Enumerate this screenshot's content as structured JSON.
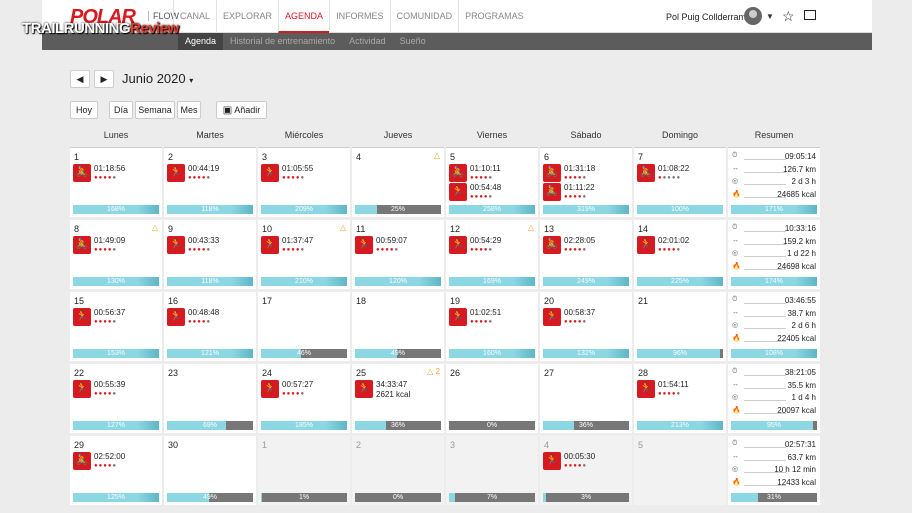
{
  "header": {
    "logo": "POLAR",
    "flow": "FLOW",
    "nav": [
      "CANAL",
      "EXPLORAR",
      "AGENDA",
      "INFORMES",
      "COMUNIDAD",
      "PROGRAMAS"
    ],
    "active": "AGENDA",
    "user": "Pol Puig Collderram"
  },
  "subnav": {
    "items": [
      "Agenda",
      "Historial de entrenamiento",
      "Actividad",
      "Sueño"
    ],
    "active": "Agenda"
  },
  "watermark": {
    "a": "TRAILRUNNING",
    "b": "Review"
  },
  "toolbar": {
    "month": "Junio 2020",
    "today": "Hoy",
    "day": "Día",
    "week": "Semana",
    "monthv": "Mes",
    "add": "Añadir"
  },
  "days": [
    "Lunes",
    "Martes",
    "Miércoles",
    "Jueves",
    "Viernes",
    "Sábado",
    "Domingo",
    "Resumen"
  ],
  "weeks": [
    {
      "cells": [
        {
          "d": "1",
          "ex": [
            {
              "t": "01:18:56",
              "s": "bike",
              "r": 4
            }
          ],
          "p": 168
        },
        {
          "d": "2",
          "ex": [
            {
              "t": "00:44:19",
              "s": "run",
              "r": 4
            }
          ],
          "p": 118
        },
        {
          "d": "3",
          "ex": [
            {
              "t": "01:05:55",
              "s": "run",
              "r": 4
            }
          ],
          "p": 209
        },
        {
          "d": "4",
          "warn": "△",
          "ex": [],
          "p": 25
        },
        {
          "d": "5",
          "ex": [
            {
              "t": "01:10:11",
              "s": "bike",
              "r": 4
            },
            {
              "t": "00:54:48",
              "s": "run",
              "r": 4
            }
          ],
          "p": 258
        },
        {
          "d": "6",
          "ex": [
            {
              "t": "01:31:18",
              "s": "bike",
              "r": 4
            },
            {
              "t": "01:11:22",
              "s": "bike",
              "r": 4
            }
          ],
          "p": 319
        },
        {
          "d": "7",
          "ex": [
            {
              "t": "01:08:22",
              "s": "bike",
              "r": 1
            }
          ],
          "p": 100
        }
      ],
      "sum": {
        "time": "09:05:14",
        "dist": "126.7 km",
        "rec": "2 d 3 h",
        "kcal": "24685 kcal",
        "p": 171
      }
    },
    {
      "cells": [
        {
          "d": "8",
          "warn": "△",
          "ex": [
            {
              "t": "01:49:09",
              "s": "bike",
              "r": 4
            }
          ],
          "p": 130
        },
        {
          "d": "9",
          "ex": [
            {
              "t": "00:43:33",
              "s": "run",
              "r": 4
            }
          ],
          "p": 118
        },
        {
          "d": "10",
          "warn": "△",
          "ex": [
            {
              "t": "01:37:47",
              "s": "run",
              "r": 4
            }
          ],
          "p": 210
        },
        {
          "d": "11",
          "ex": [
            {
              "t": "00:59:07",
              "s": "run",
              "r": 4
            }
          ],
          "p": 120
        },
        {
          "d": "12",
          "warn": "△",
          "ex": [
            {
              "t": "00:54:29",
              "s": "run",
              "r": 4
            }
          ],
          "p": 169
        },
        {
          "d": "13",
          "ex": [
            {
              "t": "02:28:05",
              "s": "bike",
              "r": 4
            }
          ],
          "p": 249
        },
        {
          "d": "14",
          "ex": [
            {
              "t": "02:01:02",
              "s": "run",
              "r": 4
            }
          ],
          "p": 225
        }
      ],
      "sum": {
        "time": "10:33:16",
        "dist": "159.2 km",
        "rec": "1 d 22 h",
        "kcal": "24698 kcal",
        "p": 174
      }
    },
    {
      "cells": [
        {
          "d": "15",
          "ex": [
            {
              "t": "00:56:37",
              "s": "run",
              "r": 4
            }
          ],
          "p": 153
        },
        {
          "d": "16",
          "ex": [
            {
              "t": "00:48:48",
              "s": "run",
              "r": 4
            }
          ],
          "p": 121
        },
        {
          "d": "17",
          "ex": [],
          "p": 46
        },
        {
          "d": "18",
          "ex": [],
          "p": 49
        },
        {
          "d": "19",
          "ex": [
            {
              "t": "01:02:51",
              "s": "run",
              "r": 4
            }
          ],
          "p": 160
        },
        {
          "d": "20",
          "ex": [
            {
              "t": "00:58:37",
              "s": "run",
              "r": 4
            }
          ],
          "p": 132
        },
        {
          "d": "21",
          "ex": [],
          "p": 96
        }
      ],
      "sum": {
        "time": "03:46:55",
        "dist": "38.7 km",
        "rec": "2 d 6 h",
        "kcal": "22405 kcal",
        "p": 108
      }
    },
    {
      "cells": [
        {
          "d": "22",
          "ex": [
            {
              "t": "00:55:39",
              "s": "run",
              "r": 4
            }
          ],
          "p": 127
        },
        {
          "d": "23",
          "ex": [],
          "p": 69
        },
        {
          "d": "24",
          "ex": [
            {
              "t": "00:57:27",
              "s": "run",
              "r": 4
            }
          ],
          "p": 185
        },
        {
          "d": "25",
          "warn": "△ 2",
          "ex": [
            {
              "t": "34:33:47",
              "t2": "2621 kcal",
              "s": "run",
              "r": 4
            }
          ],
          "p": 36
        },
        {
          "d": "26",
          "ex": [],
          "p": 0
        },
        {
          "d": "27",
          "ex": [],
          "p": 36
        },
        {
          "d": "28",
          "ex": [
            {
              "t": "01:54:11",
              "s": "run",
              "r": 4
            }
          ],
          "p": 213
        }
      ],
      "sum": {
        "time": "38:21:05",
        "dist": "35.5 km",
        "rec": "1 d 4 h",
        "kcal": "20097 kcal",
        "p": 95
      }
    },
    {
      "cells": [
        {
          "d": "29",
          "ex": [
            {
              "t": "02:52:00",
              "s": "bike",
              "r": 4
            }
          ],
          "p": 125
        },
        {
          "d": "30",
          "ex": [],
          "p": 49
        },
        {
          "d": "1",
          "o": true,
          "ex": [],
          "p": 1
        },
        {
          "d": "2",
          "o": true,
          "ex": [],
          "p": 0
        },
        {
          "d": "3",
          "o": true,
          "ex": [],
          "p": 7
        },
        {
          "d": "4",
          "o": true,
          "ex": [
            {
              "t": "00:05:30",
              "s": "run",
              "r": 4
            }
          ],
          "p": 3
        },
        {
          "d": "5",
          "o": true,
          "ex": [],
          "p": null
        }
      ],
      "sum": {
        "time": "02:57:31",
        "dist": "63.7 km",
        "rec": "10 h 12 min",
        "kcal": "12433 kcal",
        "p": 31
      }
    }
  ],
  "icons": {
    "run": "runner-icon",
    "bike": "cyclist-icon"
  },
  "colors": {
    "brand": "#d71920",
    "bar": "#8bd7e3",
    "barBg": "#777777"
  }
}
